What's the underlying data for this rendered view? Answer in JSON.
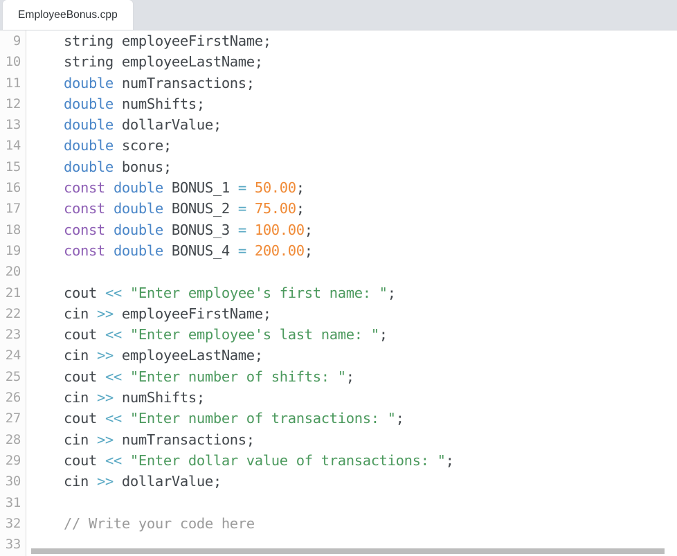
{
  "tab_bar": {
    "tabs": [
      {
        "label": "EmployeeBonus.cpp",
        "active": true
      }
    ]
  },
  "editor": {
    "language": "cpp",
    "first_visible_line": 9,
    "last_visible_line": 33,
    "colors": {
      "background": "#ffffff",
      "gutter_background": "#fcfcfc",
      "gutter_text": "#a6a6a6",
      "gutter_divider": "#dcdcdc",
      "tabbar_background": "#dee1e6",
      "active_tab_background": "#ffffff",
      "plain_text": "#43484d",
      "keyword": "#4a86c8",
      "modifier": "#8e5fb5",
      "string": "#4c9a5e",
      "number": "#f08a36",
      "operator": "#5aa9c4",
      "comment": "#9b9b9b",
      "scrollbar_thumb": "#bdbdbd"
    },
    "lines": [
      {
        "n": "9",
        "tokens": [
          {
            "t": "    ",
            "c": "t-txt"
          },
          {
            "t": "string",
            "c": "t-txt"
          },
          {
            "t": " employeeFirstName;",
            "c": "t-txt"
          }
        ]
      },
      {
        "n": "10",
        "tokens": [
          {
            "t": "    ",
            "c": "t-txt"
          },
          {
            "t": "string",
            "c": "t-txt"
          },
          {
            "t": " employeeLastName;",
            "c": "t-txt"
          }
        ]
      },
      {
        "n": "11",
        "tokens": [
          {
            "t": "    ",
            "c": "t-txt"
          },
          {
            "t": "double",
            "c": "t-kw"
          },
          {
            "t": " numTransactions;",
            "c": "t-txt"
          }
        ]
      },
      {
        "n": "12",
        "tokens": [
          {
            "t": "    ",
            "c": "t-txt"
          },
          {
            "t": "double",
            "c": "t-kw"
          },
          {
            "t": " numShifts;",
            "c": "t-txt"
          }
        ]
      },
      {
        "n": "13",
        "tokens": [
          {
            "t": "    ",
            "c": "t-txt"
          },
          {
            "t": "double",
            "c": "t-kw"
          },
          {
            "t": " dollarValue;",
            "c": "t-txt"
          }
        ]
      },
      {
        "n": "14",
        "tokens": [
          {
            "t": "    ",
            "c": "t-txt"
          },
          {
            "t": "double",
            "c": "t-kw"
          },
          {
            "t": " score;",
            "c": "t-txt"
          }
        ]
      },
      {
        "n": "15",
        "tokens": [
          {
            "t": "    ",
            "c": "t-txt"
          },
          {
            "t": "double",
            "c": "t-kw"
          },
          {
            "t": " bonus;",
            "c": "t-txt"
          }
        ]
      },
      {
        "n": "16",
        "tokens": [
          {
            "t": "    ",
            "c": "t-txt"
          },
          {
            "t": "const",
            "c": "t-mod"
          },
          {
            "t": " ",
            "c": "t-txt"
          },
          {
            "t": "double",
            "c": "t-kw"
          },
          {
            "t": " BONUS_1 ",
            "c": "t-txt"
          },
          {
            "t": "=",
            "c": "t-op"
          },
          {
            "t": " ",
            "c": "t-txt"
          },
          {
            "t": "50.00",
            "c": "t-num"
          },
          {
            "t": ";",
            "c": "t-txt"
          }
        ]
      },
      {
        "n": "17",
        "tokens": [
          {
            "t": "    ",
            "c": "t-txt"
          },
          {
            "t": "const",
            "c": "t-mod"
          },
          {
            "t": " ",
            "c": "t-txt"
          },
          {
            "t": "double",
            "c": "t-kw"
          },
          {
            "t": " BONUS_2 ",
            "c": "t-txt"
          },
          {
            "t": "=",
            "c": "t-op"
          },
          {
            "t": " ",
            "c": "t-txt"
          },
          {
            "t": "75.00",
            "c": "t-num"
          },
          {
            "t": ";",
            "c": "t-txt"
          }
        ]
      },
      {
        "n": "18",
        "tokens": [
          {
            "t": "    ",
            "c": "t-txt"
          },
          {
            "t": "const",
            "c": "t-mod"
          },
          {
            "t": " ",
            "c": "t-txt"
          },
          {
            "t": "double",
            "c": "t-kw"
          },
          {
            "t": " BONUS_3 ",
            "c": "t-txt"
          },
          {
            "t": "=",
            "c": "t-op"
          },
          {
            "t": " ",
            "c": "t-txt"
          },
          {
            "t": "100.00",
            "c": "t-num"
          },
          {
            "t": ";",
            "c": "t-txt"
          }
        ]
      },
      {
        "n": "19",
        "tokens": [
          {
            "t": "    ",
            "c": "t-txt"
          },
          {
            "t": "const",
            "c": "t-mod"
          },
          {
            "t": " ",
            "c": "t-txt"
          },
          {
            "t": "double",
            "c": "t-kw"
          },
          {
            "t": " BONUS_4 ",
            "c": "t-txt"
          },
          {
            "t": "=",
            "c": "t-op"
          },
          {
            "t": " ",
            "c": "t-txt"
          },
          {
            "t": "200.00",
            "c": "t-num"
          },
          {
            "t": ";",
            "c": "t-txt"
          }
        ]
      },
      {
        "n": "20",
        "tokens": []
      },
      {
        "n": "21",
        "tokens": [
          {
            "t": "    cout ",
            "c": "t-txt"
          },
          {
            "t": "<<",
            "c": "t-op"
          },
          {
            "t": " ",
            "c": "t-txt"
          },
          {
            "t": "\"Enter employee's first name: \"",
            "c": "t-str"
          },
          {
            "t": ";",
            "c": "t-txt"
          }
        ]
      },
      {
        "n": "22",
        "tokens": [
          {
            "t": "    cin ",
            "c": "t-txt"
          },
          {
            "t": ">>",
            "c": "t-op"
          },
          {
            "t": " employeeFirstName;",
            "c": "t-txt"
          }
        ]
      },
      {
        "n": "23",
        "tokens": [
          {
            "t": "    cout ",
            "c": "t-txt"
          },
          {
            "t": "<<",
            "c": "t-op"
          },
          {
            "t": " ",
            "c": "t-txt"
          },
          {
            "t": "\"Enter employee's last name: \"",
            "c": "t-str"
          },
          {
            "t": ";",
            "c": "t-txt"
          }
        ]
      },
      {
        "n": "24",
        "tokens": [
          {
            "t": "    cin ",
            "c": "t-txt"
          },
          {
            "t": ">>",
            "c": "t-op"
          },
          {
            "t": " employeeLastName;",
            "c": "t-txt"
          }
        ]
      },
      {
        "n": "25",
        "tokens": [
          {
            "t": "    cout ",
            "c": "t-txt"
          },
          {
            "t": "<<",
            "c": "t-op"
          },
          {
            "t": " ",
            "c": "t-txt"
          },
          {
            "t": "\"Enter number of shifts: \"",
            "c": "t-str"
          },
          {
            "t": ";",
            "c": "t-txt"
          }
        ]
      },
      {
        "n": "26",
        "tokens": [
          {
            "t": "    cin ",
            "c": "t-txt"
          },
          {
            "t": ">>",
            "c": "t-op"
          },
          {
            "t": " numShifts;",
            "c": "t-txt"
          }
        ]
      },
      {
        "n": "27",
        "tokens": [
          {
            "t": "    cout ",
            "c": "t-txt"
          },
          {
            "t": "<<",
            "c": "t-op"
          },
          {
            "t": " ",
            "c": "t-txt"
          },
          {
            "t": "\"Enter number of transactions: \"",
            "c": "t-str"
          },
          {
            "t": ";",
            "c": "t-txt"
          }
        ]
      },
      {
        "n": "28",
        "tokens": [
          {
            "t": "    cin ",
            "c": "t-txt"
          },
          {
            "t": ">>",
            "c": "t-op"
          },
          {
            "t": " numTransactions;",
            "c": "t-txt"
          }
        ]
      },
      {
        "n": "29",
        "tokens": [
          {
            "t": "    cout ",
            "c": "t-txt"
          },
          {
            "t": "<<",
            "c": "t-op"
          },
          {
            "t": " ",
            "c": "t-txt"
          },
          {
            "t": "\"Enter dollar value of transactions: \"",
            "c": "t-str"
          },
          {
            "t": ";",
            "c": "t-txt"
          }
        ]
      },
      {
        "n": "30",
        "tokens": [
          {
            "t": "    cin ",
            "c": "t-txt"
          },
          {
            "t": ">>",
            "c": "t-op"
          },
          {
            "t": " dollarValue;",
            "c": "t-txt"
          }
        ]
      },
      {
        "n": "31",
        "tokens": []
      },
      {
        "n": "32",
        "tokens": [
          {
            "t": "    ",
            "c": "t-txt"
          },
          {
            "t": "// Write your code here",
            "c": "t-cmt"
          }
        ]
      },
      {
        "n": "33",
        "tokens": []
      }
    ]
  },
  "scrollbar": {
    "orientation": "horizontal",
    "thumb_fraction": "1.0"
  }
}
